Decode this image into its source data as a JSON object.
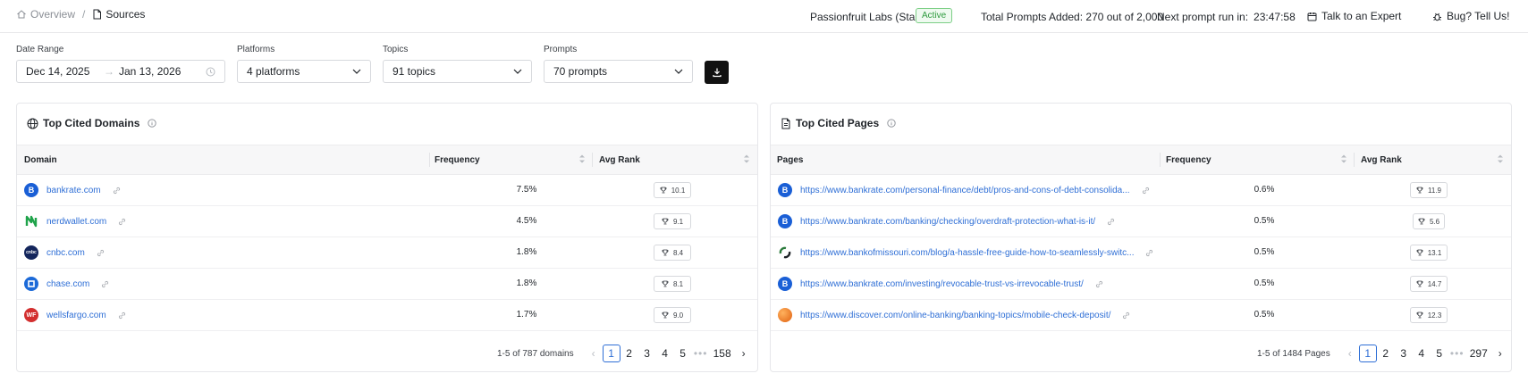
{
  "breadcrumb": {
    "parent": "Overview",
    "current": "Sources"
  },
  "topbar": {
    "org": "Passionfruit Labs (Starter)",
    "status": "Active",
    "prompts_added": "Total Prompts Added: 270 out of 2,000",
    "next_run_label": "Next prompt run in:",
    "next_run_time": "23:47:58",
    "talk_expert": "Talk to an Expert",
    "bug": "Bug? Tell Us!"
  },
  "filters": {
    "date_range": {
      "label": "Date Range",
      "start": "Dec 14, 2025",
      "end": "Jan 13, 2026"
    },
    "platforms": {
      "label": "Platforms",
      "value": "4 platforms"
    },
    "topics": {
      "label": "Topics",
      "value": "91 topics"
    },
    "prompts": {
      "label": "Prompts",
      "value": "70 prompts"
    }
  },
  "domains": {
    "title": "Top Cited Domains",
    "columns": [
      "Domain",
      "Frequency",
      "Avg Rank"
    ],
    "rows": [
      {
        "name": "bankrate.com",
        "frequency": "7.5%",
        "rank": "10.1",
        "logo": "B",
        "color": "#1a5fd6"
      },
      {
        "name": "nerdwallet.com",
        "frequency": "4.5%",
        "rank": "9.1",
        "logo": "N",
        "color": "#1fa34a"
      },
      {
        "name": "cnbc.com",
        "frequency": "1.8%",
        "rank": "8.4",
        "logo": "cnbc",
        "color": "#14265c"
      },
      {
        "name": "chase.com",
        "frequency": "1.8%",
        "rank": "8.1",
        "logo": "",
        "color": "#1c6ad8"
      },
      {
        "name": "wellsfargo.com",
        "frequency": "1.7%",
        "rank": "9.0",
        "logo": "WF",
        "color": "#d32f2f"
      }
    ],
    "pagination": {
      "summary": "1-5 of 787 domains",
      "pages": [
        "1",
        "2",
        "3",
        "4",
        "5",
        "•••",
        "158"
      ]
    }
  },
  "pages": {
    "title": "Top Cited Pages",
    "columns": [
      "Pages",
      "Frequency",
      "Avg Rank"
    ],
    "rows": [
      {
        "url": "https://www.bankrate.com/personal-finance/debt/pros-and-cons-of-debt-consolida...",
        "frequency": "0.6%",
        "rank": "11.9",
        "logo": "B",
        "color": "#1a5fd6"
      },
      {
        "url": "https://www.bankrate.com/banking/checking/overdraft-protection-what-is-it/",
        "frequency": "0.5%",
        "rank": "5.6",
        "logo": "B",
        "color": "#1a5fd6"
      },
      {
        "url": "https://www.bankofmissouri.com/blog/a-hassle-free-guide-how-to-seamlessly-switc...",
        "frequency": "0.5%",
        "rank": "13.1",
        "logo": "",
        "color": "#2b7a3b"
      },
      {
        "url": "https://www.bankrate.com/investing/revocable-trust-vs-irrevocable-trust/",
        "frequency": "0.5%",
        "rank": "14.7",
        "logo": "B",
        "color": "#1a5fd6"
      },
      {
        "url": "https://www.discover.com/online-banking/banking-topics/mobile-check-deposit/",
        "frequency": "0.5%",
        "rank": "12.3",
        "logo": "",
        "color": "#f07a1b"
      }
    ],
    "pagination": {
      "summary": "1-5 of 1484 Pages",
      "pages": [
        "1",
        "2",
        "3",
        "4",
        "5",
        "•••",
        "297"
      ]
    }
  }
}
